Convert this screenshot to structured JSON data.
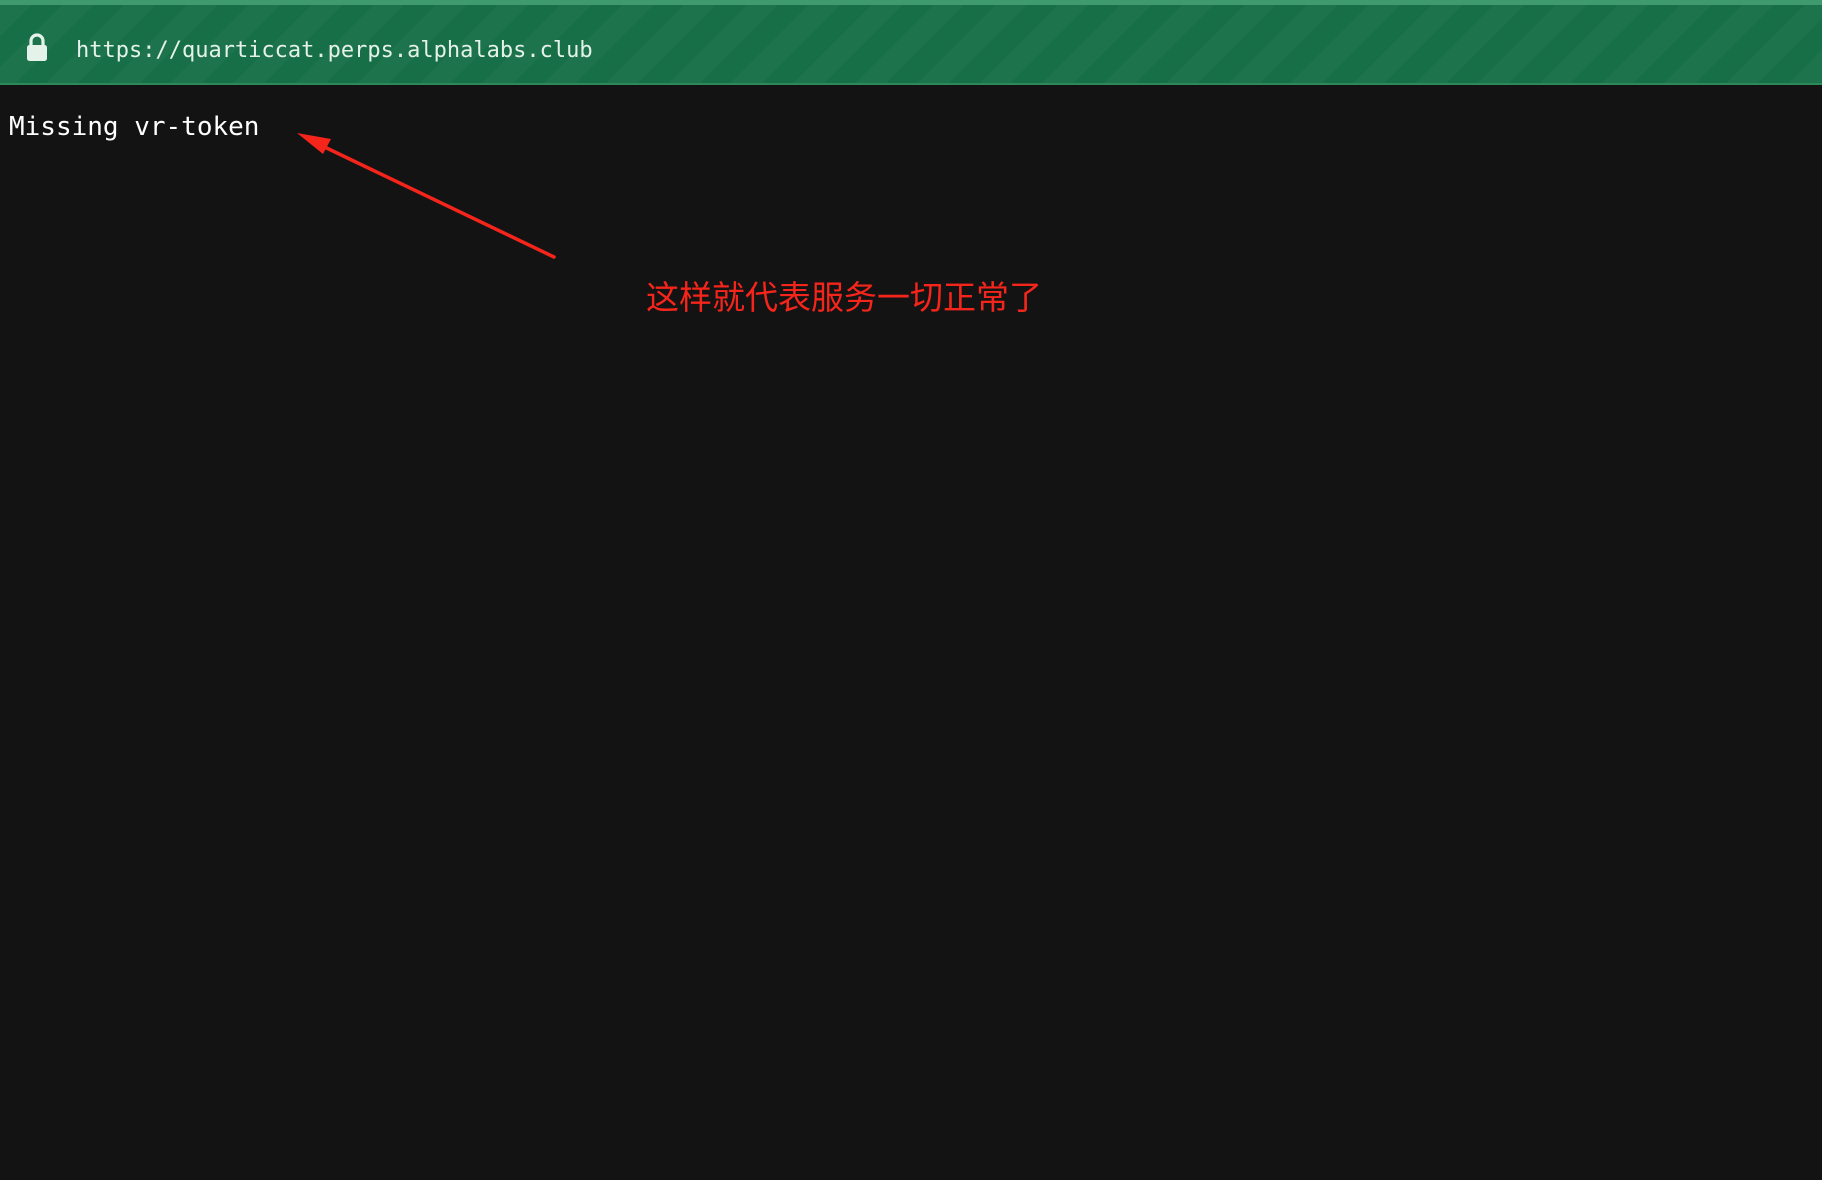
{
  "address_bar": {
    "url": "https://quarticcat.perps.alphalabs.club",
    "lock_icon": "lock-icon",
    "bar_color": "#176f47"
  },
  "page": {
    "message": "Missing vr-token",
    "background_color": "#131313",
    "text_color": "#ffffff"
  },
  "annotation": {
    "text": "这样就代表服务一切正常了",
    "color": "#f5251b"
  }
}
